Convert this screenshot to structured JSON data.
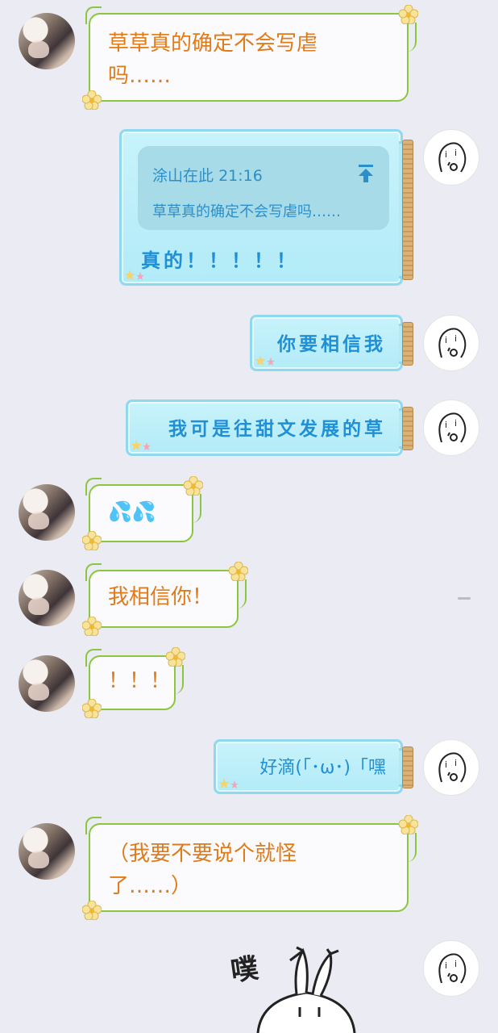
{
  "messages": [
    {
      "side": "left",
      "text": "草草真的确定不会写虐吗……"
    },
    {
      "side": "right",
      "quote": {
        "author": "涂山在此",
        "time": "21:16",
        "text": "草草真的确定不会写虐吗……"
      },
      "text": "真的！！！！！"
    },
    {
      "side": "right",
      "text": "你要相信我"
    },
    {
      "side": "right",
      "text": "我可是往甜文发展的草"
    },
    {
      "side": "left",
      "text": "💦💦"
    },
    {
      "side": "left",
      "text": "我相信你！"
    },
    {
      "side": "left",
      "text": "！！！"
    },
    {
      "side": "right",
      "text": "好滴(「･ω･)「嘿"
    },
    {
      "side": "left",
      "text": "（我要不要说个就怪了……）"
    },
    {
      "side": "right",
      "sticker_text": "噗"
    }
  ],
  "colors": {
    "background": "#eaebf3",
    "left_text": "#e07b1a",
    "left_border": "#8cc63f",
    "right_text": "#1f8fd6",
    "jar_fill": "#c8f3fb",
    "jar_border": "#8ed9f0"
  },
  "icons": {
    "quote_jump": "upload-arrow-icon",
    "flower": "flower-icon",
    "stars": "star-icon"
  }
}
